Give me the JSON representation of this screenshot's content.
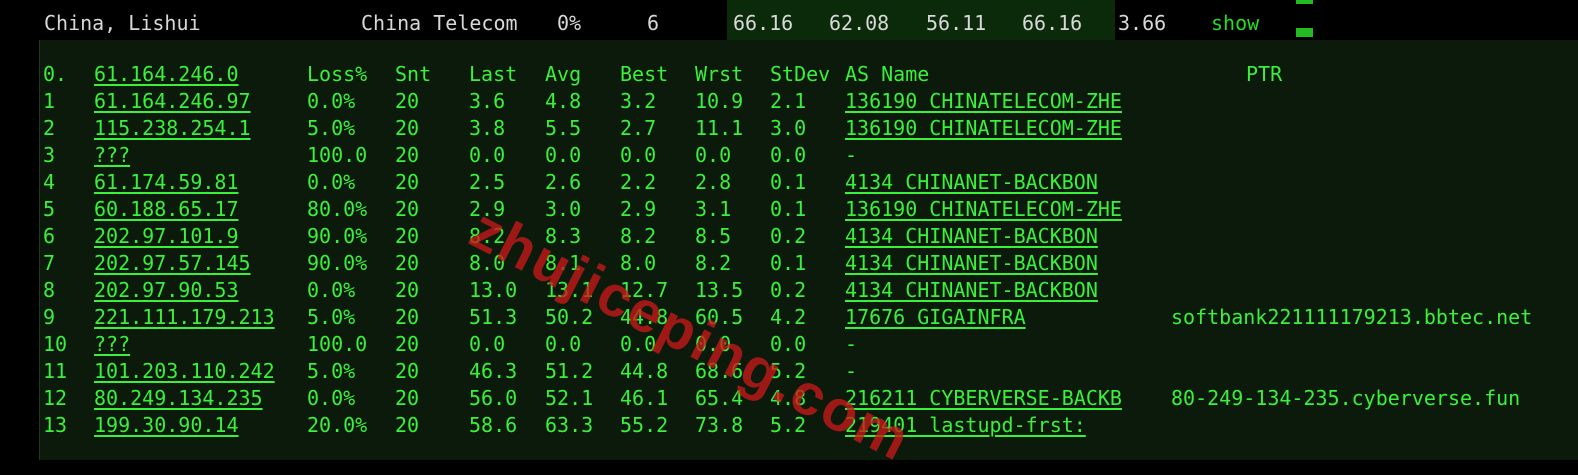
{
  "summary": {
    "location": "China, Lishui",
    "isp": "China Telecom",
    "loss": "0%",
    "sent": "6",
    "last": "66.16",
    "avg": "62.08",
    "best": "56.11",
    "worst": "66.16",
    "stdev": "3.66",
    "action_label": "show"
  },
  "headers": {
    "hop": "0.",
    "host": "61.164.246.0",
    "loss": "Loss%",
    "snt": "Snt",
    "last": "Last",
    "avg": "Avg",
    "best": "Best",
    "wrst": "Wrst",
    "stdev": "StDev",
    "as_name": "AS Name",
    "ptr": "PTR"
  },
  "hops": [
    {
      "hop": "1",
      "host": "61.164.246.97",
      "loss": "0.0%",
      "snt": "20",
      "last": "3.6",
      "avg": "4.8",
      "best": "3.2",
      "wrst": "10.9",
      "stdev": "2.1",
      "as_name": "136190 CHINATELECOM-ZHE",
      "ptr": ""
    },
    {
      "hop": "2",
      "host": "115.238.254.1",
      "loss": "5.0%",
      "snt": "20",
      "last": "3.8",
      "avg": "5.5",
      "best": "2.7",
      "wrst": "11.1",
      "stdev": "3.0",
      "as_name": "136190 CHINATELECOM-ZHE",
      "ptr": ""
    },
    {
      "hop": "3",
      "host": "???",
      "loss": "100.0",
      "snt": "20",
      "last": "0.0",
      "avg": "0.0",
      "best": "0.0",
      "wrst": "0.0",
      "stdev": "0.0",
      "as_name": "-",
      "ptr": ""
    },
    {
      "hop": "4",
      "host": "61.174.59.81",
      "loss": "0.0%",
      "snt": "20",
      "last": "2.5",
      "avg": "2.6",
      "best": "2.2",
      "wrst": "2.8",
      "stdev": "0.1",
      "as_name": "4134  CHINANET-BACKBON",
      "ptr": ""
    },
    {
      "hop": "5",
      "host": "60.188.65.17",
      "loss": "80.0%",
      "snt": "20",
      "last": "2.9",
      "avg": "3.0",
      "best": "2.9",
      "wrst": "3.1",
      "stdev": "0.1",
      "as_name": "136190 CHINATELECOM-ZHE",
      "ptr": ""
    },
    {
      "hop": "6",
      "host": "202.97.101.9",
      "loss": "90.0%",
      "snt": "20",
      "last": "8.2",
      "avg": "8.3",
      "best": "8.2",
      "wrst": "8.5",
      "stdev": "0.2",
      "as_name": "4134  CHINANET-BACKBON",
      "ptr": ""
    },
    {
      "hop": "7",
      "host": "202.97.57.145",
      "loss": "90.0%",
      "snt": "20",
      "last": "8.0",
      "avg": "8.1",
      "best": "8.0",
      "wrst": "8.2",
      "stdev": "0.1",
      "as_name": "4134  CHINANET-BACKBON",
      "ptr": ""
    },
    {
      "hop": "8",
      "host": "202.97.90.53",
      "loss": "0.0%",
      "snt": "20",
      "last": "13.0",
      "avg": "13.1",
      "best": "12.7",
      "wrst": "13.5",
      "stdev": "0.2",
      "as_name": "4134  CHINANET-BACKBON",
      "ptr": ""
    },
    {
      "hop": "9",
      "host": "221.111.179.213",
      "loss": "5.0%",
      "snt": "20",
      "last": "51.3",
      "avg": "50.2",
      "best": "44.8",
      "wrst": "60.5",
      "stdev": "4.2",
      "as_name": "17676 GIGAINFRA",
      "ptr": "softbank221111179213.bbtec.net"
    },
    {
      "hop": "10",
      "host": "???",
      "loss": "100.0",
      "snt": "20",
      "last": "0.0",
      "avg": "0.0",
      "best": "0.0",
      "wrst": "0.0",
      "stdev": "0.0",
      "as_name": "-",
      "ptr": ""
    },
    {
      "hop": "11",
      "host": "101.203.110.242",
      "loss": "5.0%",
      "snt": "20",
      "last": "46.3",
      "avg": "51.2",
      "best": "44.8",
      "wrst": "68.6",
      "stdev": "5.2",
      "as_name": "-",
      "ptr": ""
    },
    {
      "hop": "12",
      "host": "80.249.134.235",
      "loss": "0.0%",
      "snt": "20",
      "last": "56.0",
      "avg": "52.1",
      "best": "46.1",
      "wrst": "65.4",
      "stdev": "4.8",
      "as_name": "216211 CYBERVERSE-BACKB",
      "ptr": "80-249-134-235.cyberverse.fun"
    },
    {
      "hop": "13",
      "host": "199.30.90.14",
      "loss": "20.0%",
      "snt": "20",
      "last": "58.6",
      "avg": "63.3",
      "best": "55.2",
      "wrst": "73.8",
      "stdev": "5.2",
      "as_name": "219401 lastupd-frst:",
      "ptr": ""
    }
  ],
  "watermark": "zhujiceping.com",
  "colors": {
    "background": "#000000",
    "panel": "#0b1a0b",
    "text_green": "#3af03a",
    "link_green": "#22dd22",
    "watermark": "#c81919"
  }
}
